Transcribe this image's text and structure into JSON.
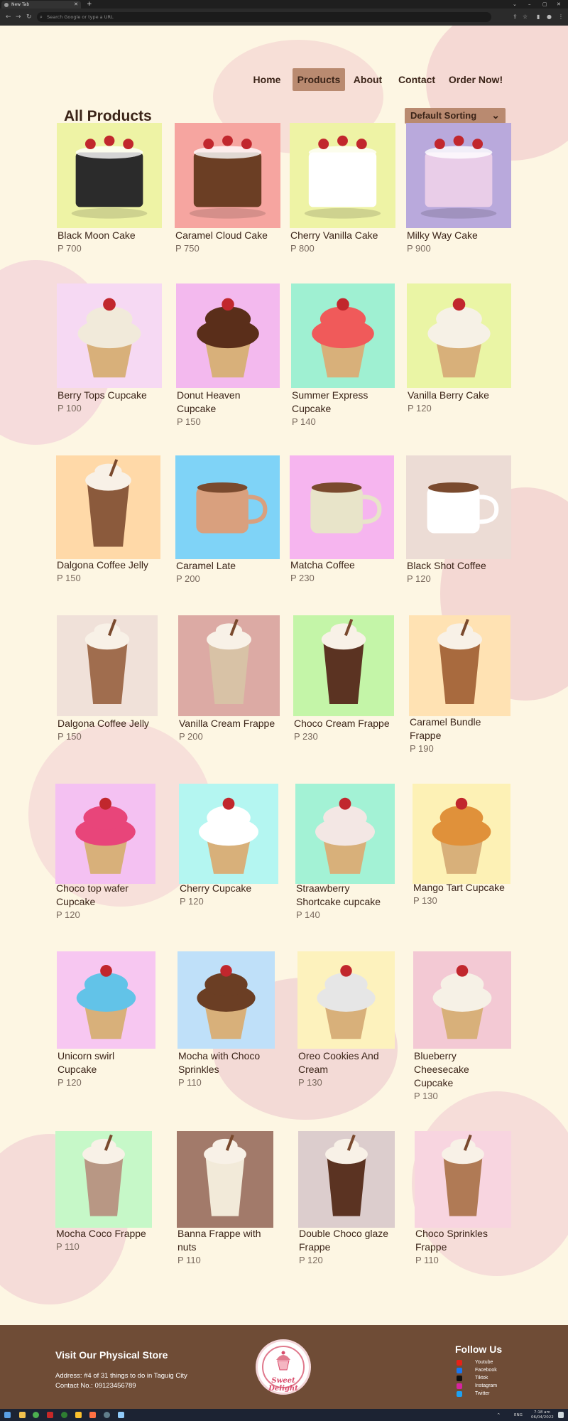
{
  "browser": {
    "tab_title": "New Tab",
    "address_placeholder": "Search Google or type a URL"
  },
  "nav": {
    "items": [
      "Home",
      "Products",
      "About",
      "Contact",
      "Order Now!"
    ],
    "active": "Products"
  },
  "page_title": "All Products",
  "sort_label": "Default Sorting",
  "products": [
    {
      "name": "Black Moon Cake",
      "price": "P 700"
    },
    {
      "name": "Caramel Cloud Cake",
      "price": "P 750"
    },
    {
      "name": "Cherry Vanilla Cake",
      "price": "P 800"
    },
    {
      "name": "Milky Way Cake",
      "price": "P 900"
    },
    {
      "name": "Berry Tops Cupcake",
      "price": "P 100"
    },
    {
      "name": "Donut Heaven Cupcake",
      "price": "P 150"
    },
    {
      "name": "Summer Express Cupcake",
      "price": "P 140"
    },
    {
      "name": "Vanilla Berry Cake",
      "price": "P 120"
    },
    {
      "name": "Dalgona Coffee Jelly",
      "price": "P 150"
    },
    {
      "name": "Caramel Late",
      "price": "P 200"
    },
    {
      "name": "Matcha Coffee",
      "price": "P 230"
    },
    {
      "name": "Black Shot Coffee",
      "price": "P 120"
    },
    {
      "name": "Dalgona Coffee Jelly",
      "price": "P 150"
    },
    {
      "name": "Vanilla Cream Frappe",
      "price": "P 200"
    },
    {
      "name": "Choco Cream Frappe",
      "price": "P 230"
    },
    {
      "name": "Caramel Bundle Frappe",
      "price": "P 190"
    },
    {
      "name": "Choco top wafer Cupcake",
      "price": "P 120"
    },
    {
      "name": "Cherry Cupcake",
      "price": "P 120"
    },
    {
      "name": "Straawberry Shortcake cupcake",
      "price": "P 140"
    },
    {
      "name": "Mango Tart Cupcake",
      "price": "P 130"
    },
    {
      "name": "Unicorn swirl Cupcake",
      "price": "P 120"
    },
    {
      "name": "Mocha with Choco Sprinkles",
      "price": "P 110"
    },
    {
      "name": "Oreo Cookies And Cream",
      "price": "P 130"
    },
    {
      "name": "Blueberry Cheesecake Cupcake",
      "price": "P 130"
    },
    {
      "name": "Mocha Coco Frappe",
      "price": "P 110"
    },
    {
      "name": "Banna Frappe with nuts",
      "price": "P 110"
    },
    {
      "name": "Double Choco glaze Frappe",
      "price": "P 120"
    },
    {
      "name": "Choco Sprinkles Frappe",
      "price": "P 110"
    }
  ],
  "footer": {
    "store_title": "Visit Our Physical Store",
    "address": "Address: #4 of 31 things to do in Taguig City",
    "contact": "Contact No.: 09123456789",
    "logo_text": "Sweet Delight",
    "follow_title": "Follow Us",
    "social": [
      {
        "label": "Youtube",
        "icon": "youtube-icon",
        "color": "#e62117"
      },
      {
        "label": "Facebook",
        "icon": "facebook-icon",
        "color": "#1877f2"
      },
      {
        "label": "Tiktok",
        "icon": "tiktok-icon",
        "color": "#111111"
      },
      {
        "label": "Instagram",
        "icon": "instagram-icon",
        "color": "#d6249f"
      },
      {
        "label": "Twitter",
        "icon": "twitter-icon",
        "color": "#1da1f2"
      }
    ]
  },
  "taskbar": {
    "time": "7:18 am",
    "date": "06/04/2022",
    "lang": "ENG"
  },
  "colors": {
    "page_bg": "#fdf6e3",
    "accent": "#b98a70",
    "footer_bg": "#6f4c36",
    "text": "#3b2418"
  }
}
